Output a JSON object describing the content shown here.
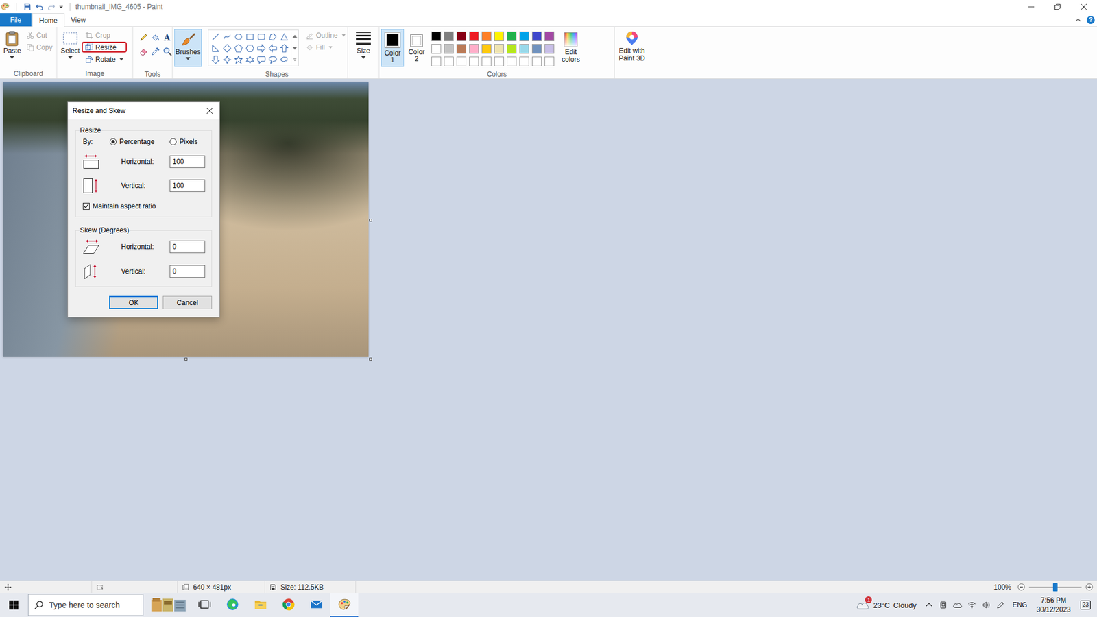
{
  "window": {
    "title": "thumbnail_IMG_4605 - Paint",
    "help": "?"
  },
  "menu_tabs": [
    {
      "label": "File",
      "selected": false,
      "kind": "file"
    },
    {
      "label": "Home",
      "selected": true,
      "kind": "tab"
    },
    {
      "label": "View",
      "selected": false,
      "kind": "tab"
    }
  ],
  "ribbon": {
    "clipboard": {
      "label": "Clipboard",
      "paste": "Paste",
      "items": [
        {
          "label": "Cut",
          "disabled": true
        },
        {
          "label": "Copy",
          "disabled": true
        }
      ]
    },
    "image": {
      "label": "Image",
      "select": "Select",
      "items": [
        {
          "label": "Crop",
          "disabled": true,
          "highlighted": false,
          "dropdown": false
        },
        {
          "label": "Resize",
          "disabled": false,
          "highlighted": true,
          "dropdown": false
        },
        {
          "label": "Rotate",
          "disabled": false,
          "highlighted": false,
          "dropdown": true
        }
      ]
    },
    "tools": {
      "label": "Tools",
      "text_tool": "A"
    },
    "brushes": {
      "label": "Brushes",
      "selected": true
    },
    "shapes": {
      "label": "Shapes",
      "options": [
        {
          "label": "Outline",
          "disabled": true
        },
        {
          "label": "Fill",
          "disabled": true
        }
      ]
    },
    "size": {
      "label": "Size"
    },
    "colors": {
      "label": "Colors",
      "slots": [
        {
          "label": "Color 1",
          "color": "#000000",
          "selected": true
        },
        {
          "label": "Color 2",
          "color": "#ffffff",
          "selected": false
        }
      ],
      "palette": [
        {
          "color": "#000000"
        },
        {
          "color": "#7f7f7f"
        },
        {
          "color": "#880015"
        },
        {
          "color": "#ed1c24"
        },
        {
          "color": "#ff7f27"
        },
        {
          "color": "#fff200"
        },
        {
          "color": "#22b14c"
        },
        {
          "color": "#00a2e8"
        },
        {
          "color": "#3f48cc"
        },
        {
          "color": "#a349a4"
        },
        {
          "color": "#ffffff"
        },
        {
          "color": "#c3c3c3"
        },
        {
          "color": "#b97a57"
        },
        {
          "color": "#ffaec9"
        },
        {
          "color": "#ffc90e"
        },
        {
          "color": "#efe4b0"
        },
        {
          "color": "#b5e61d"
        },
        {
          "color": "#99d9ea"
        },
        {
          "color": "#7092be"
        },
        {
          "color": "#c8bfe7"
        },
        {
          "color": "#ffffff"
        },
        {
          "color": "#ffffff"
        },
        {
          "color": "#ffffff"
        },
        {
          "color": "#ffffff"
        },
        {
          "color": "#ffffff"
        },
        {
          "color": "#ffffff"
        },
        {
          "color": "#ffffff"
        },
        {
          "color": "#ffffff"
        },
        {
          "color": "#ffffff"
        },
        {
          "color": "#ffffff"
        }
      ],
      "edit_colors": "Edit colors"
    },
    "paint3d": {
      "label": "Edit with Paint 3D"
    }
  },
  "dialog": {
    "title": "Resize and Skew",
    "resize": {
      "label": "Resize",
      "by": "By:",
      "modes": [
        {
          "label": "Percentage",
          "selected": true
        },
        {
          "label": "Pixels",
          "selected": false
        }
      ],
      "fields": [
        {
          "kind": "horizontal",
          "label": "Horizontal:",
          "value": "100"
        },
        {
          "kind": "vertical",
          "label": "Vertical:",
          "value": "100"
        }
      ],
      "aspect": {
        "label": "Maintain aspect ratio",
        "checked": true
      }
    },
    "skew": {
      "label": "Skew (Degrees)",
      "fields": [
        {
          "kind": "horizontal",
          "label": "Horizontal:",
          "value": "0"
        },
        {
          "kind": "vertical",
          "label": "Vertical:",
          "value": "0"
        }
      ]
    },
    "buttons": [
      {
        "label": "OK",
        "default": true
      },
      {
        "label": "Cancel",
        "default": false
      }
    ]
  },
  "status_bar": {
    "dimensions": "640 × 481px",
    "size": "Size: 112.5KB",
    "zoom": "100%",
    "zoom_level": 0.5
  },
  "taskbar": {
    "search_placeholder": "Type here to search",
    "apps": [
      {
        "kind": "widgets",
        "active": false
      },
      {
        "kind": "task-view",
        "active": false
      },
      {
        "kind": "edge",
        "active": false
      },
      {
        "kind": "explorer",
        "active": false
      },
      {
        "kind": "chrome",
        "active": false
      },
      {
        "kind": "mail",
        "active": false
      },
      {
        "kind": "paint",
        "active": true
      }
    ],
    "weather": {
      "temperature": "23°C",
      "condition": "Cloudy",
      "badge": "1"
    },
    "language": "ENG",
    "time": "7:56 PM",
    "date": "30/12/2023",
    "notifications": "23"
  }
}
